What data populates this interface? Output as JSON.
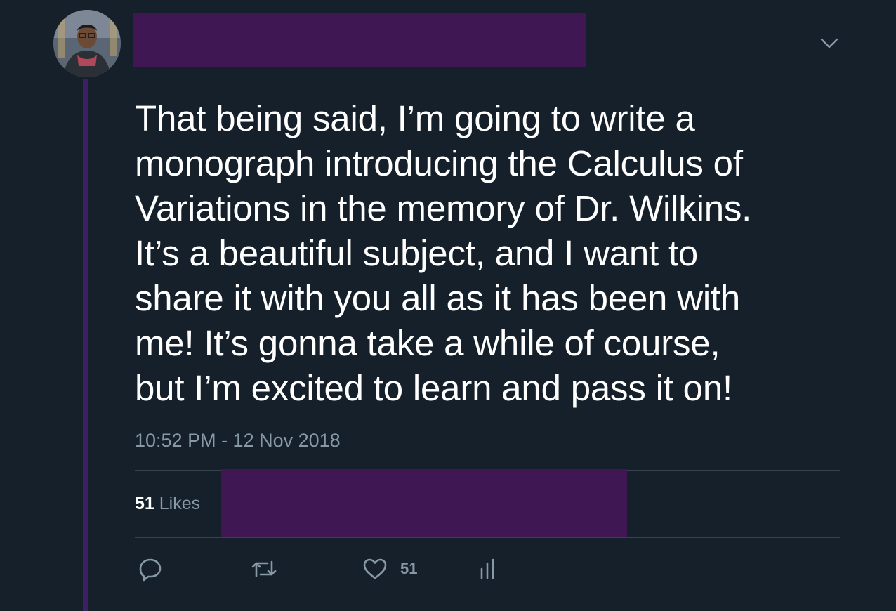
{
  "tweet": {
    "text": "That being said, I’m going to write a\nmonograph introducing the Calculus of\nVariations in the memory of Dr. Wilkins.\nIt’s a beautiful subject, and I want to\nshare it with you all as it has been with\nme! It’s gonna take a while of course,\nbut I’m excited to learn and pass it on!",
    "timestamp": "10:52 PM - 12 Nov 2018",
    "likes_count": "51",
    "likes_label": " Likes"
  },
  "actions": {
    "reply_icon": "reply-icon",
    "retweet_icon": "retweet-icon",
    "like_icon": "heart-icon",
    "like_count": "51",
    "analytics_icon": "analytics-icon"
  },
  "colors": {
    "background": "#15202b",
    "thread_line": "#3f1f63",
    "redaction": "#3f1752",
    "secondary_text": "#8899a6",
    "divider": "#38444d"
  }
}
